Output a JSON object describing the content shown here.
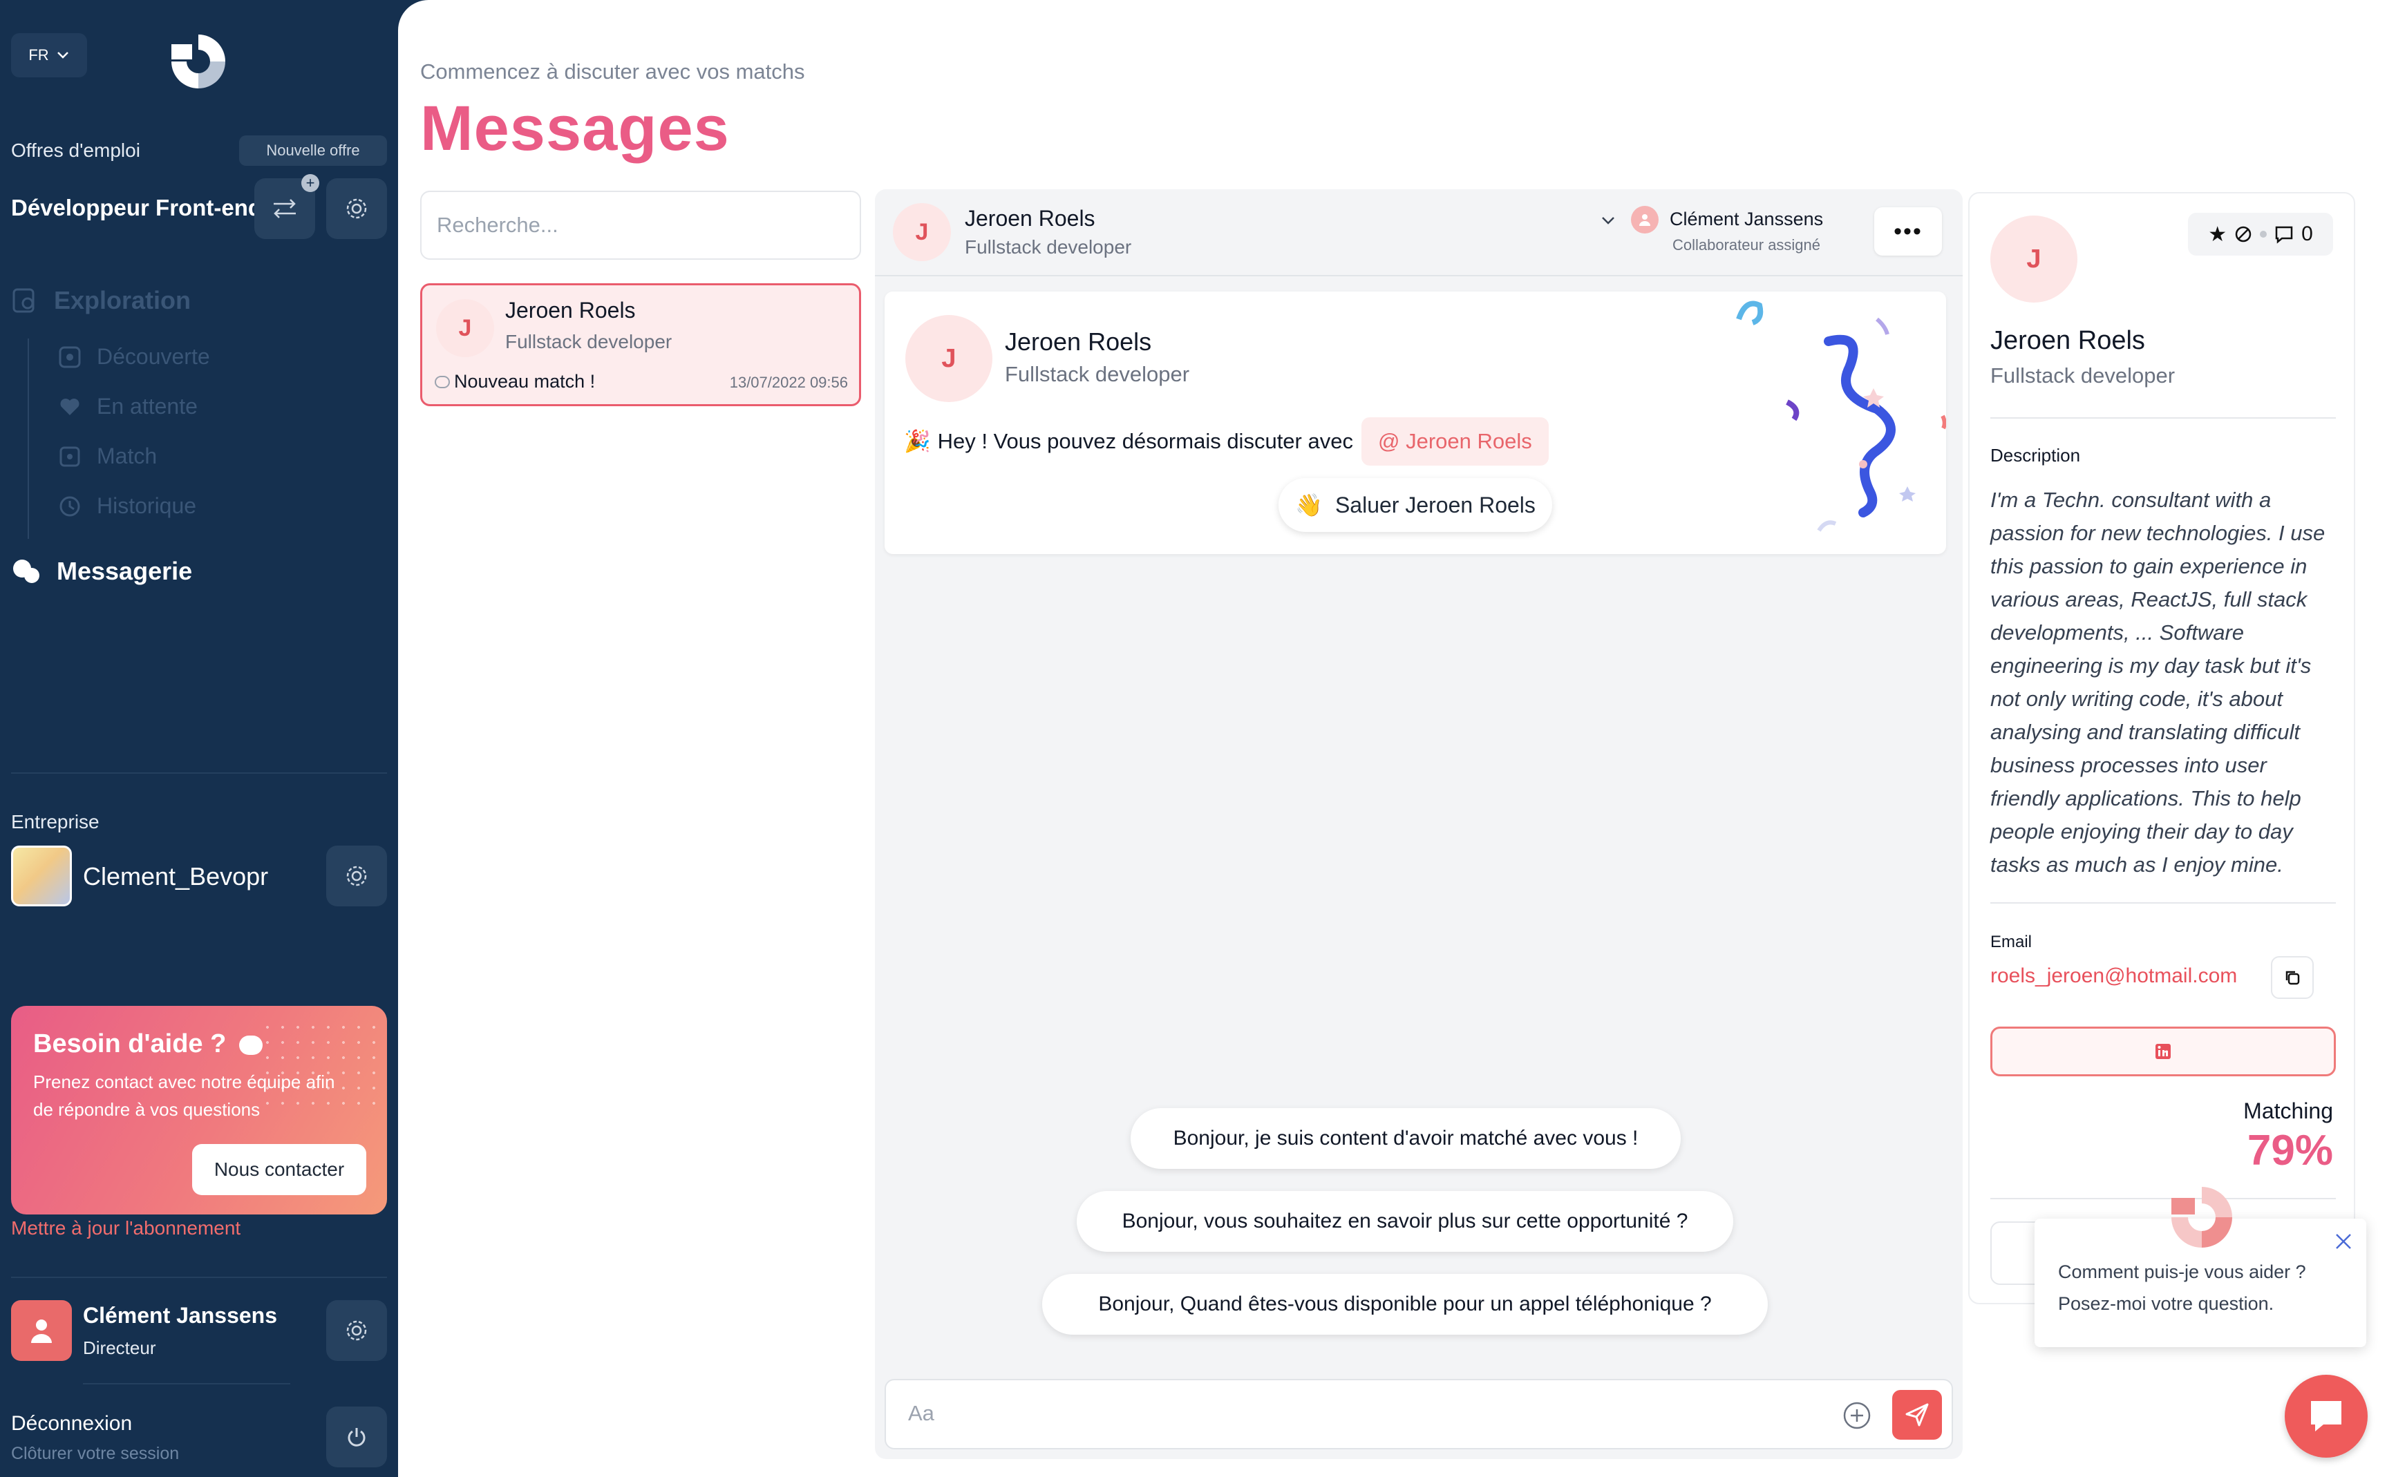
{
  "sidebar": {
    "lang": "FR",
    "jobs_label": "Offres d'emploi",
    "new_offer": "Nouvelle offre",
    "current_job": "Développeur Front-end",
    "nav": {
      "exploration": "Exploration",
      "discover": "Découverte",
      "waiting": "En attente",
      "match": "Match",
      "history": "Historique",
      "messaging": "Messagerie"
    },
    "company_label": "Entreprise",
    "company_name": "Clement_Bevopr",
    "help": {
      "title": "Besoin d'aide ?",
      "text": "Prenez contact avec notre équipe afin de répondre à vos questions",
      "button": "Nous contacter"
    },
    "upgrade": "Mettre à jour l'abonnement",
    "user": {
      "name": "Clément Janssens",
      "role": "Directeur"
    },
    "logout": {
      "title": "Déconnexion",
      "subtitle": "Clôturer votre session"
    }
  },
  "page": {
    "subtitle": "Commencez à discuter avec vos matchs",
    "title": "Messages"
  },
  "conversations": {
    "search_placeholder": "Recherche...",
    "items": [
      {
        "initial": "J",
        "name": "Jeroen Roels",
        "role": "Fullstack developer",
        "preview": "Nouveau match !",
        "date": "13/07/2022 09:56"
      }
    ]
  },
  "chat": {
    "header": {
      "initial": "J",
      "name": "Jeroen Roels",
      "role": "Fullstack developer",
      "assignee_name": "Clément Janssens",
      "assignee_label": "Collaborateur assigné"
    },
    "match_card": {
      "initial": "J",
      "name": "Jeroen Roels",
      "role": "Fullstack developer",
      "text": "Hey ! Vous pouvez désormais discuter avec",
      "mention": "@ Jeroen Roels",
      "greet_button": "Saluer Jeroen Roels"
    },
    "suggestions": [
      "Bonjour, je suis content d'avoir matché avec vous !",
      "Bonjour, vous souhaitez en savoir plus sur cette opportunité ?",
      "Bonjour, Quand êtes-vous disponible pour un appel téléphonique ?"
    ],
    "composer_placeholder": "Aa"
  },
  "profile": {
    "initial": "J",
    "count": "0",
    "name": "Jeroen Roels",
    "role": "Fullstack developer",
    "description_label": "Description",
    "description": "I'm a Techn. consultant with a passion for new technologies. I use this passion to gain experience in various areas, ReactJS, full stack developments, ... Software engineering is my day task but it's not only writing code, it's about analysing and translating difficult business processes into user friendly applications. This to help people enjoying their day to day tasks as much as I enjoy mine.",
    "email_label": "Email",
    "email": "roels_jeroen@hotmail.com",
    "matching_label": "Matching",
    "matching_value": "79%"
  },
  "widget": {
    "line1": "Comment puis-je vous aider ?",
    "line2": "Posez-moi votre question."
  },
  "colors": {
    "sidebar_bg": "#15304f",
    "accent_pink": "#ea5c86",
    "accent_red": "#ef5b5b"
  }
}
